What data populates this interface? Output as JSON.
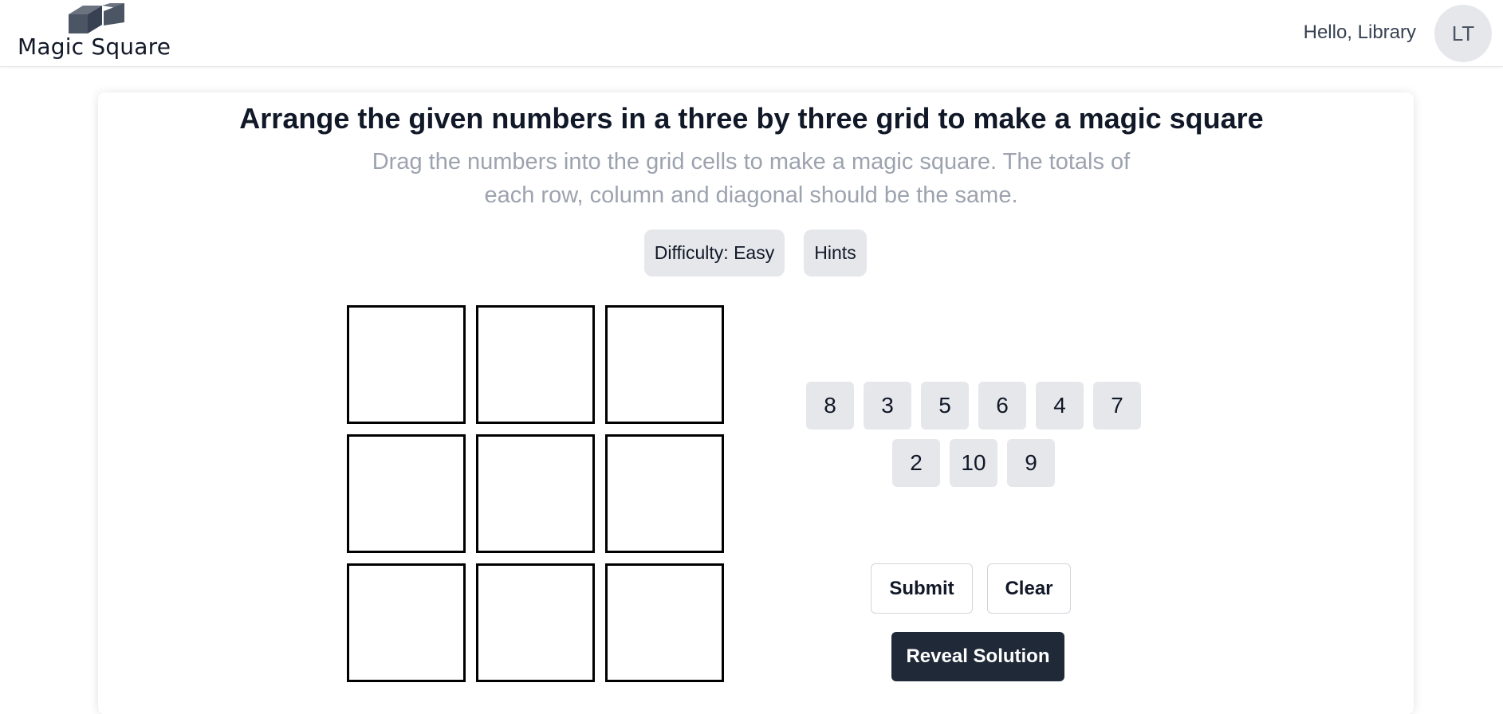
{
  "app": {
    "brand": "Magic Square"
  },
  "header": {
    "greeting": "Hello, Library",
    "avatar_initials": "LT"
  },
  "puzzle": {
    "title": "Arrange the given numbers in a three by three grid to make a magic square",
    "subtitle": "Drag the numbers into the grid cells to make a magic square. The totals of each row, column and diagonal should be the same.",
    "difficulty_label": "Difficulty: Easy",
    "hints_label": "Hints",
    "grid": [
      [
        "",
        "",
        ""
      ],
      [
        "",
        "",
        ""
      ],
      [
        "",
        "",
        ""
      ]
    ],
    "tiles": [
      "8",
      "3",
      "5",
      "6",
      "4",
      "7",
      "2",
      "10",
      "9"
    ],
    "submit_label": "Submit",
    "clear_label": "Clear",
    "reveal_label": "Reveal Solution"
  },
  "colors": {
    "accent_dark": "#1f2937",
    "tile_bg": "#e5e7eb",
    "subtitle": "#9ca3af"
  }
}
